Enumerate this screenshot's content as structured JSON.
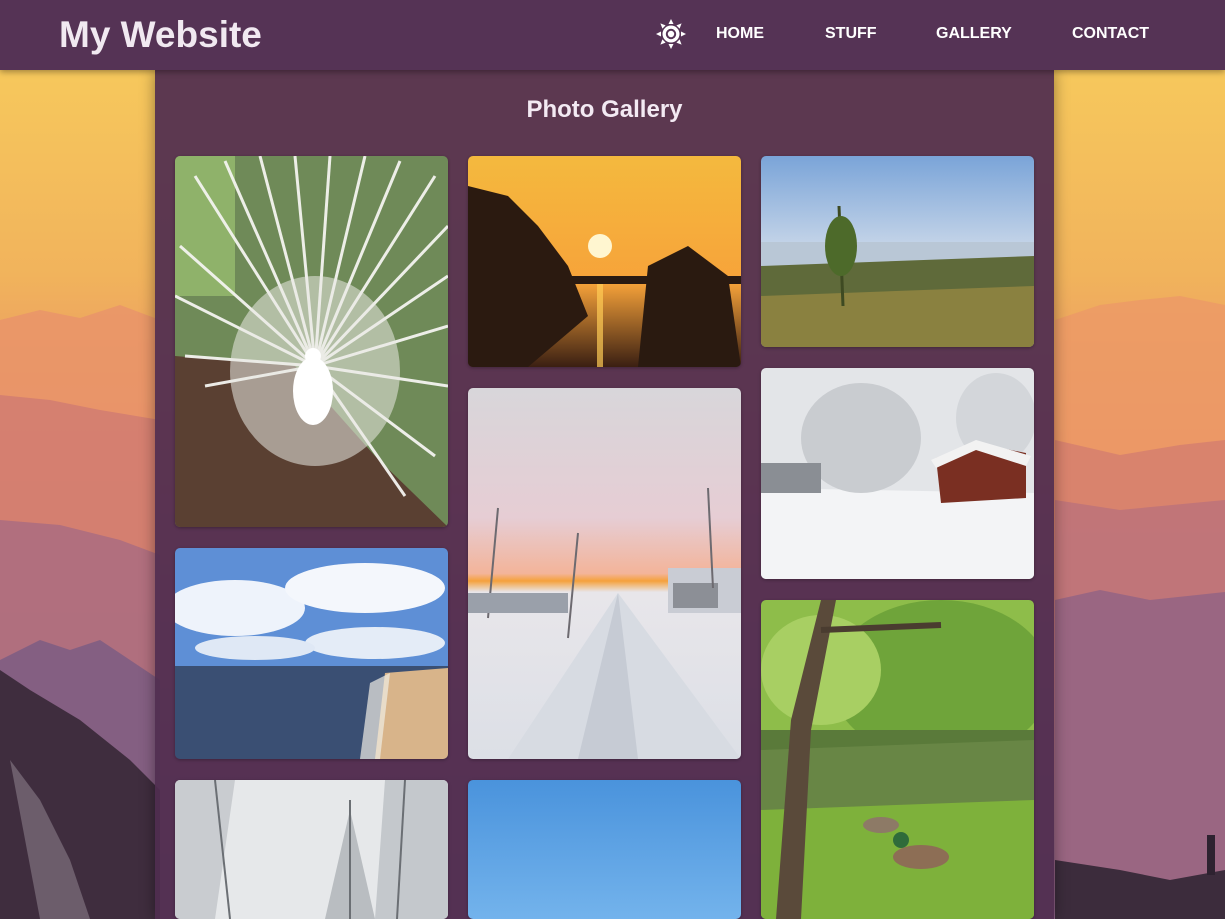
{
  "header": {
    "brand": "My Website",
    "theme_toggle_icon": "sun-icon",
    "nav": [
      {
        "label": "HOME"
      },
      {
        "label": "STUFF"
      },
      {
        "label": "GALLERY"
      },
      {
        "label": "CONTACT"
      }
    ]
  },
  "main": {
    "title": "Photo Gallery",
    "photos": [
      {
        "subject": "white peacock"
      },
      {
        "subject": "sunset over water"
      },
      {
        "subject": "seaside meadow"
      },
      {
        "subject": "snowy red barn"
      },
      {
        "subject": "snowy road at sunset"
      },
      {
        "subject": "sandy beach"
      },
      {
        "subject": "green pond with ducks"
      },
      {
        "subject": "snowy forest"
      },
      {
        "subject": "blue sky"
      }
    ]
  },
  "colors": {
    "header_bg": "#553355",
    "panel_bg": "#502d50"
  }
}
